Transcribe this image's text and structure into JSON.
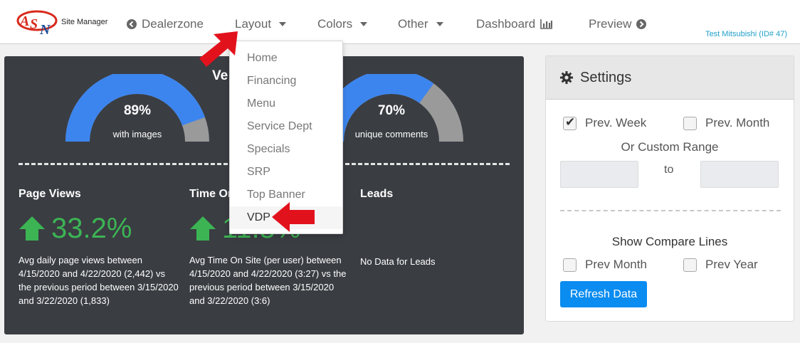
{
  "brand": {
    "logo_text": "ASN",
    "site_label": "Site Manager"
  },
  "nav": {
    "dealerzone": "Dealerzone",
    "layout": "Layout",
    "colors": "Colors",
    "other": "Other",
    "dashboard": "Dashboard",
    "preview": "Preview"
  },
  "dealer": "Test Mitsubishi (ID# 47)",
  "dropdown": {
    "items": [
      "Home",
      "Financing",
      "Menu",
      "Service Dept",
      "Specials",
      "SRP",
      "Top Banner",
      "VDP"
    ],
    "hovered": "VDP"
  },
  "dashboard": {
    "title_partial": "Ve",
    "gauges": [
      {
        "value": 89,
        "percent_label": "89%",
        "caption": "with images"
      },
      {
        "value": 70,
        "percent_label": "70%",
        "caption": "unique comments"
      }
    ],
    "stats": [
      {
        "title": "Page Views",
        "change": "33.2%",
        "trend": "up",
        "description": "Avg daily page views between 4/15/2020 and 4/22/2020 (2,442) vs the previous period between 3/15/2020 and 3/22/2020 (1,833)"
      },
      {
        "title": "Time On Site",
        "change": "11.5%",
        "trend": "up",
        "description": "Avg Time On Site (per user) between 4/15/2020 and 4/22/2020 (3:27) vs the previous period between 3/15/2020 and 3/22/2020 (3:6)"
      },
      {
        "title": "Leads",
        "description": "No Data for Leads"
      }
    ]
  },
  "settings": {
    "title": "Settings",
    "prev_week": {
      "label": "Prev. Week",
      "checked": true
    },
    "prev_month": {
      "label": "Prev. Month",
      "checked": false
    },
    "custom_range_label": "Or Custom Range",
    "to_label": "to",
    "start_value": "",
    "end_value": "",
    "compare_title": "Show Compare Lines",
    "compare_prev_month": {
      "label": "Prev Month",
      "checked": false
    },
    "compare_prev_year": {
      "label": "Prev Year",
      "checked": false
    },
    "refresh_label": "Refresh Data"
  },
  "colors": {
    "gauge_fill": "#3d85ee",
    "gauge_rest": "#9a9a9a",
    "trend_up": "#3cb454",
    "primary_button": "#0a8cf0",
    "annotation_arrow": "#e2121d"
  }
}
